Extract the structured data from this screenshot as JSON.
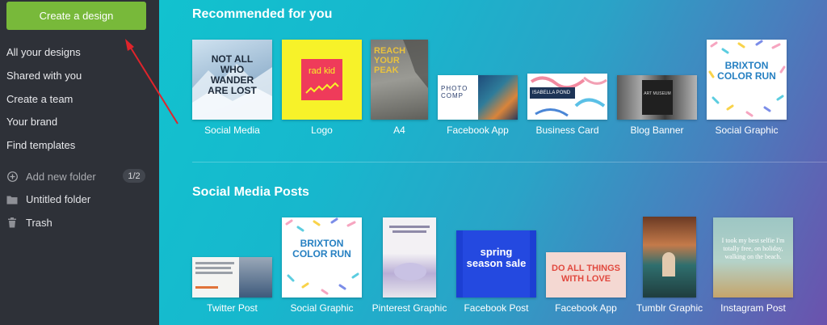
{
  "sidebar": {
    "create_button": "Create a design",
    "nav": [
      "All your designs",
      "Shared with you",
      "Create a team",
      "Your brand",
      "Find templates"
    ],
    "add_folder": "Add new folder",
    "folder_count": "1/2",
    "folder": "Untitled folder",
    "trash": "Trash"
  },
  "sections": {
    "recommended_title": "Recommended for you",
    "social_title": "Social Media Posts"
  },
  "recommended": [
    {
      "label": "Social Media",
      "thumb_text": "NOT ALL WHO WANDER ARE LOST"
    },
    {
      "label": "Logo",
      "thumb_text": "rad kid"
    },
    {
      "label": "A4",
      "thumb_text": "REACH YOUR PEAK"
    },
    {
      "label": "Facebook App",
      "thumb_text": "PHOTO COMP"
    },
    {
      "label": "Business Card",
      "thumb_text": "ISABELLA POND"
    },
    {
      "label": "Blog Banner",
      "thumb_text": "ART MUSEUM"
    },
    {
      "label": "Social Graphic",
      "thumb_text": "BRIXTON COLOR RUN"
    }
  ],
  "social": [
    {
      "label": "Twitter Post"
    },
    {
      "label": "Social Graphic",
      "thumb_text": "BRIXTON COLOR RUN"
    },
    {
      "label": "Pinterest Graphic"
    },
    {
      "label": "Facebook Post",
      "thumb_text": "spring season sale"
    },
    {
      "label": "Facebook App",
      "thumb_text": "DO ALL THINGS WITH LOVE"
    },
    {
      "label": "Tumblr Graphic"
    },
    {
      "label": "Instagram Post",
      "thumb_text": "I took my best selfie I'm totally free, on holiday, walking on the beach."
    }
  ],
  "colors": {
    "accent_green": "#78b93a",
    "sidebar_bg": "#2e3138",
    "arrow_red": "#e0242b"
  }
}
